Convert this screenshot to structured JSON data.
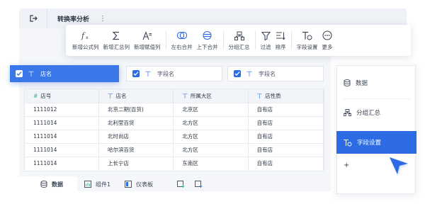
{
  "titlebar": {
    "title": "转换率分析",
    "more_glyph": "⋮"
  },
  "toolbar": {
    "items": [
      {
        "label": "新增公式列",
        "icon": "formula-icon"
      },
      {
        "label": "新增汇总列",
        "icon": "sigma-icon"
      },
      {
        "label": "新增赋值列",
        "icon": "assign-value-icon"
      },
      {
        "label": "左右合并",
        "icon": "merge-horizontal-icon"
      },
      {
        "label": "上下合并",
        "icon": "merge-vertical-icon"
      },
      {
        "label": "分组汇总",
        "icon": "group-summary-icon"
      },
      {
        "label": "过滤",
        "icon": "filter-icon"
      },
      {
        "label": "排序",
        "icon": "sort-icon"
      },
      {
        "label": "字段设置",
        "icon": "field-settings-icon"
      },
      {
        "label": "更多",
        "icon": "more-icon"
      }
    ]
  },
  "fields": {
    "primary": "店名",
    "secondary": [
      "字段名",
      "字段名"
    ],
    "type_glyph": "丅"
  },
  "table": {
    "columns": [
      {
        "label": "店号",
        "type": "#"
      },
      {
        "label": "店名",
        "type": "丅"
      },
      {
        "label": "所属大区",
        "type": "丅"
      },
      {
        "label": "店性质",
        "type": "丅"
      }
    ],
    "rows": [
      [
        "1111012",
        "北京二期(百货)",
        "北京区",
        "自有店"
      ],
      [
        "1111014",
        "北利莹百货",
        "北方区",
        "自有店"
      ],
      [
        "1111014",
        "北时尚店",
        "北方区",
        "自有店"
      ],
      [
        "1111014",
        "哈尔滨百货",
        "北方区",
        "自有店"
      ],
      [
        "1111014",
        "上长宁店",
        "东南区",
        "自有店"
      ]
    ]
  },
  "bottom_tabs": [
    {
      "label": "数据",
      "icon": "database-icon"
    },
    {
      "label": "组件1",
      "icon": "component-icon"
    },
    {
      "label": "仪表板",
      "icon": "dashboard-icon"
    }
  ],
  "right_panel": {
    "items": [
      "数据",
      "分组汇总",
      "字段设置"
    ],
    "add": "+"
  },
  "colors": {
    "accent": "#2d6be4",
    "background": "#f4f6f9"
  }
}
